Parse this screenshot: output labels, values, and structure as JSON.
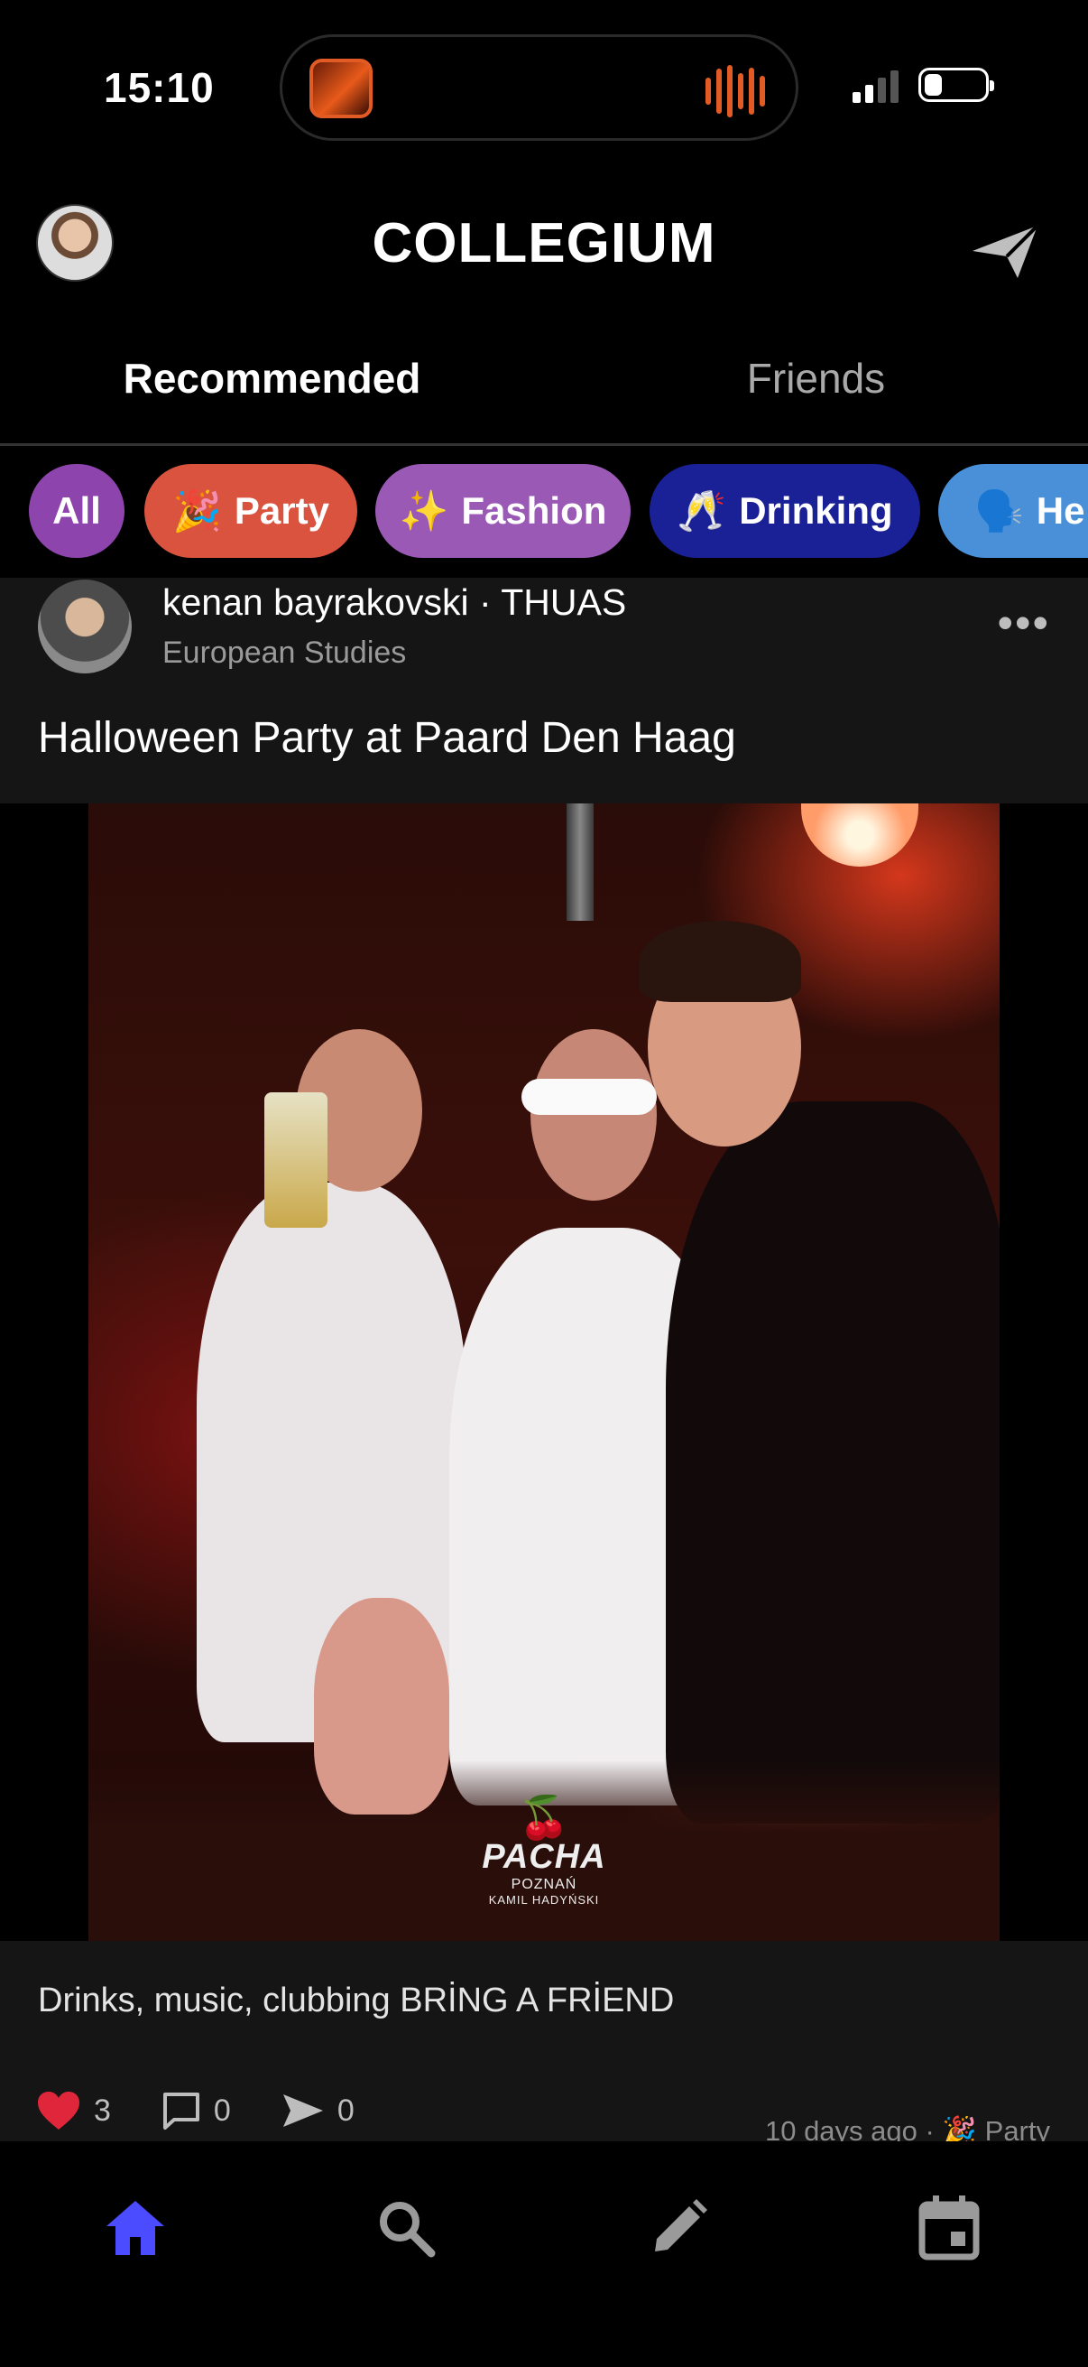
{
  "status_bar": {
    "time": "15:10"
  },
  "header": {
    "title": "COLLEGIUM"
  },
  "tabs": [
    {
      "label": "Recommended",
      "active": true
    },
    {
      "label": "Friends",
      "active": false
    }
  ],
  "categories": [
    {
      "label": "All",
      "emoji": "",
      "color": "#8e44ad"
    },
    {
      "label": "Party",
      "emoji": "🎉",
      "color": "#d9533f"
    },
    {
      "label": "Fashion",
      "emoji": "✨",
      "color": "#9b59b6"
    },
    {
      "label": "Drinking",
      "emoji": "🥂",
      "color": "#1a2196"
    },
    {
      "label": "He",
      "emoji": "🗣️",
      "color": "#4a90d9"
    }
  ],
  "post": {
    "username": "kenan bayrakovski · THUAS",
    "program": "European Studies",
    "title": "Halloween Party at Paard Den Haag",
    "image_watermark": {
      "brand": "PACHA",
      "city": "POZNAŃ",
      "photographer": "KAMIL HADYŃSKI"
    },
    "description": "Drinks, music, clubbing BRİNG A FRİEND",
    "likes": "3",
    "comments": "0",
    "shares": "0",
    "meta": "10 days ago · 🎉 Party"
  },
  "colors": {
    "accent": "#4b4bff",
    "like": "#e0263a"
  },
  "bottom_nav": [
    {
      "icon": "home-icon",
      "active": true
    },
    {
      "icon": "search-icon",
      "active": false
    },
    {
      "icon": "pencil-icon",
      "active": false
    },
    {
      "icon": "calendar-icon",
      "active": false
    }
  ]
}
